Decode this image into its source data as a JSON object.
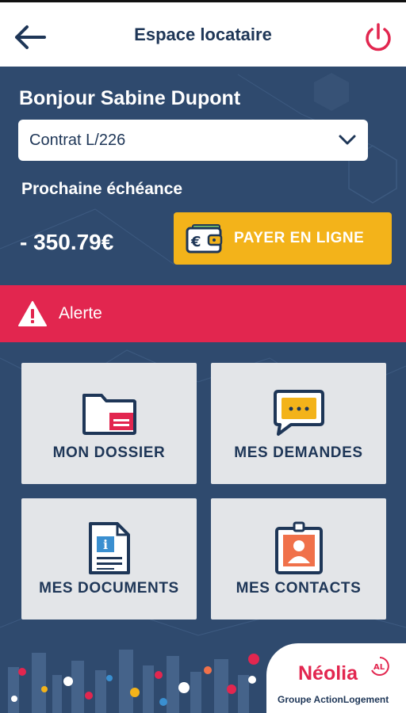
{
  "header": {
    "title": "Espace locataire",
    "back_icon": "arrow-left-icon",
    "power_icon": "power-icon"
  },
  "account": {
    "greeting": "Bonjour Sabine Dupont",
    "contract_value": "Contrat L/226",
    "next_due_label": "Prochaine échéance",
    "amount": "- 350.79€",
    "pay_button_label": "PAYER EN LIGNE",
    "pay_icon": "wallet-euro-icon"
  },
  "alert": {
    "label": "Alerte",
    "icon": "warning-triangle-icon"
  },
  "tiles": [
    {
      "label": "MON DOSSIER",
      "icon": "folder-icon"
    },
    {
      "label": "MES DEMANDES",
      "icon": "chat-bubble-icon"
    },
    {
      "label": "MES DOCUMENTS",
      "icon": "document-info-icon"
    },
    {
      "label": "MES CONTACTS",
      "icon": "contact-badge-icon"
    }
  ],
  "footer": {
    "brand": "Néolia",
    "brand_mark": "AL",
    "brand_subtitle": "Groupe ActionLogement"
  },
  "colors": {
    "navy": "#2f4a6e",
    "dark_text": "#1e3657",
    "accent_red": "#e2264f",
    "accent_yellow": "#f3b31a",
    "tile_bg": "#e3e5e8"
  }
}
